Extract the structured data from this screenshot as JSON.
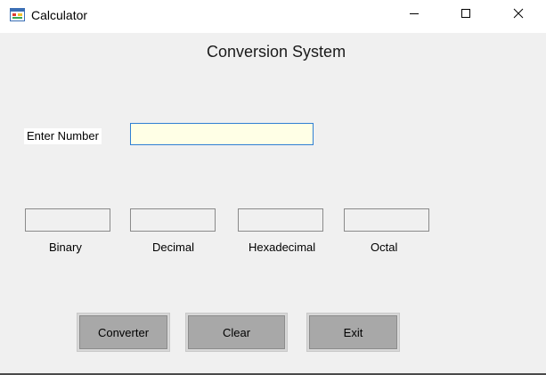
{
  "window": {
    "title": "Calculator",
    "icon": "app-window-icon",
    "controls": {
      "minimize": "minimize-icon",
      "maximize": "maximize-icon",
      "close": "close-icon"
    }
  },
  "form": {
    "heading": "Conversion System",
    "input_label": "Enter Number",
    "input_value": "",
    "outputs": [
      {
        "label": "Binary",
        "value": ""
      },
      {
        "label": "Decimal",
        "value": ""
      },
      {
        "label": "Hexadecimal",
        "value": ""
      },
      {
        "label": "Octal",
        "value": ""
      }
    ],
    "buttons": {
      "convert": "Converter",
      "clear": "Clear",
      "exit": "Exit"
    }
  },
  "colors": {
    "window_bg": "#f0f0f0",
    "input_bg": "#ffffe6",
    "input_border_focus": "#2f7fd4",
    "button_bg": "#a8a8a8"
  }
}
